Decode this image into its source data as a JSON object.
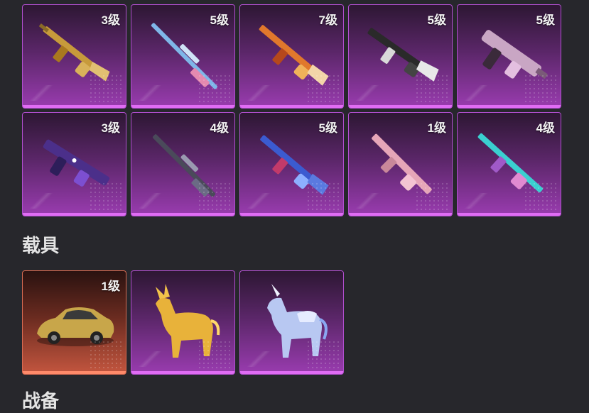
{
  "weapons": [
    {
      "level": "3级",
      "skin": "gold-rifle"
    },
    {
      "level": "5级",
      "skin": "blue-sniper"
    },
    {
      "level": "7级",
      "skin": "orange-rifle"
    },
    {
      "level": "5级",
      "skin": "black-white-rifle"
    },
    {
      "level": "5级",
      "skin": "pink-smg"
    },
    {
      "level": "3级",
      "skin": "galaxy-smg"
    },
    {
      "level": "4级",
      "skin": "dark-sniper"
    },
    {
      "level": "5级",
      "skin": "blue-rifle"
    },
    {
      "level": "1级",
      "skin": "pink-rifle"
    },
    {
      "level": "4级",
      "skin": "cyan-rifle"
    }
  ],
  "vehicles_section_title": "载具",
  "vehicles": [
    {
      "level": "1级",
      "skin": "gold-car",
      "rarity": "red"
    },
    {
      "level": "",
      "skin": "golden-qilin",
      "rarity": "purple"
    },
    {
      "level": "",
      "skin": "crystal-unicorn",
      "rarity": "purple"
    }
  ],
  "next_section_title": "战备",
  "colors": {
    "background": "#27272c",
    "purple_accent": "#e06cf4",
    "red_accent": "#ff8a6a"
  }
}
